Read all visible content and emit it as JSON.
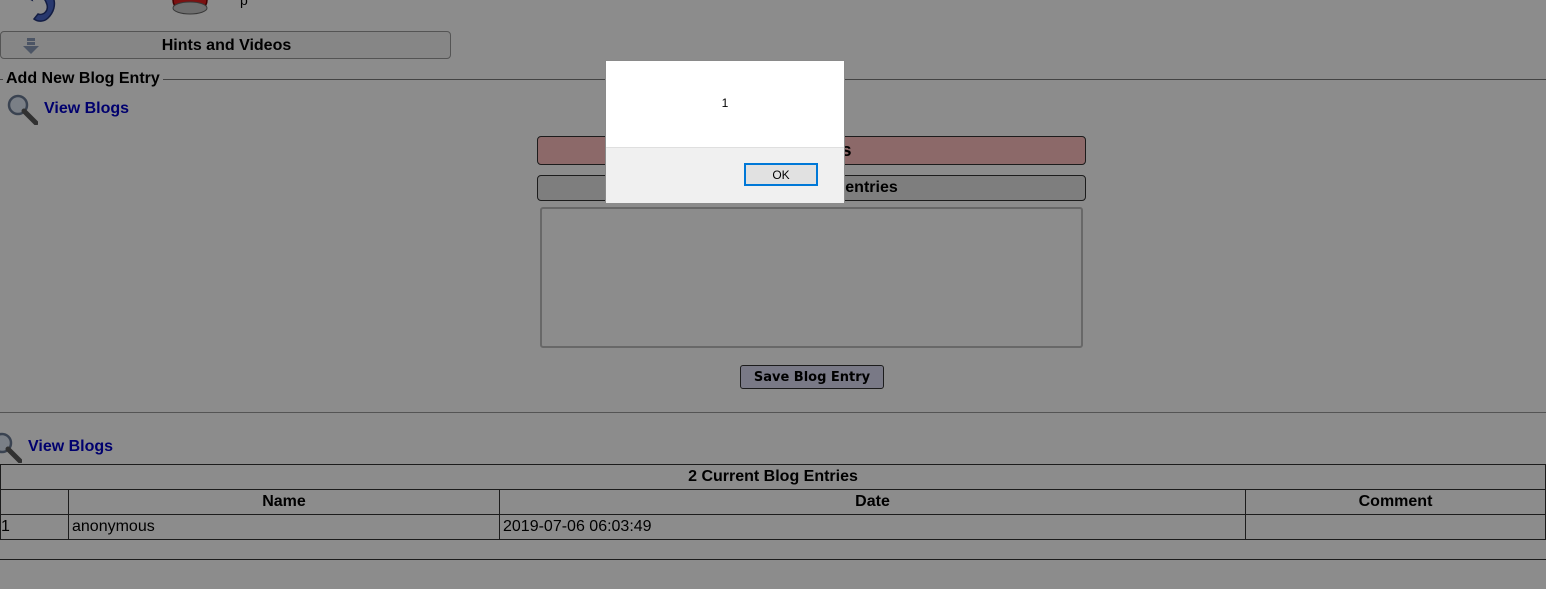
{
  "toolbar": {
    "back_icon": "back-arrow-icon",
    "red_icon": "red-button-icon",
    "partial_label": "p"
  },
  "hints": {
    "label": "Hints and Videos",
    "icon": "down-arrow-icon"
  },
  "add_blog": {
    "legend": "Add New Blog Entry",
    "view_blogs_label": "View Blogs",
    "user_banner": "onymous",
    "note_banner": "allowed in blog entries",
    "textarea_value": "",
    "save_label": "Save Blog Entry"
  },
  "blogs": {
    "view_blogs_label": "View Blogs",
    "caption": "2 Current Blog Entries",
    "columns": [
      "",
      "Name",
      "Date",
      "Comment"
    ],
    "rows": [
      {
        "num": "1",
        "name": "anonymous",
        "date": "2019-07-06 06:03:49",
        "comment": ""
      }
    ]
  },
  "dialog": {
    "message": "1",
    "ok_label": "OK"
  },
  "colors": {
    "user_banner_bg": "#ffc0c0",
    "note_banner_bg": "#e6e6e6",
    "link": "#0000c8",
    "ok_focus_border": "#0078d7"
  }
}
